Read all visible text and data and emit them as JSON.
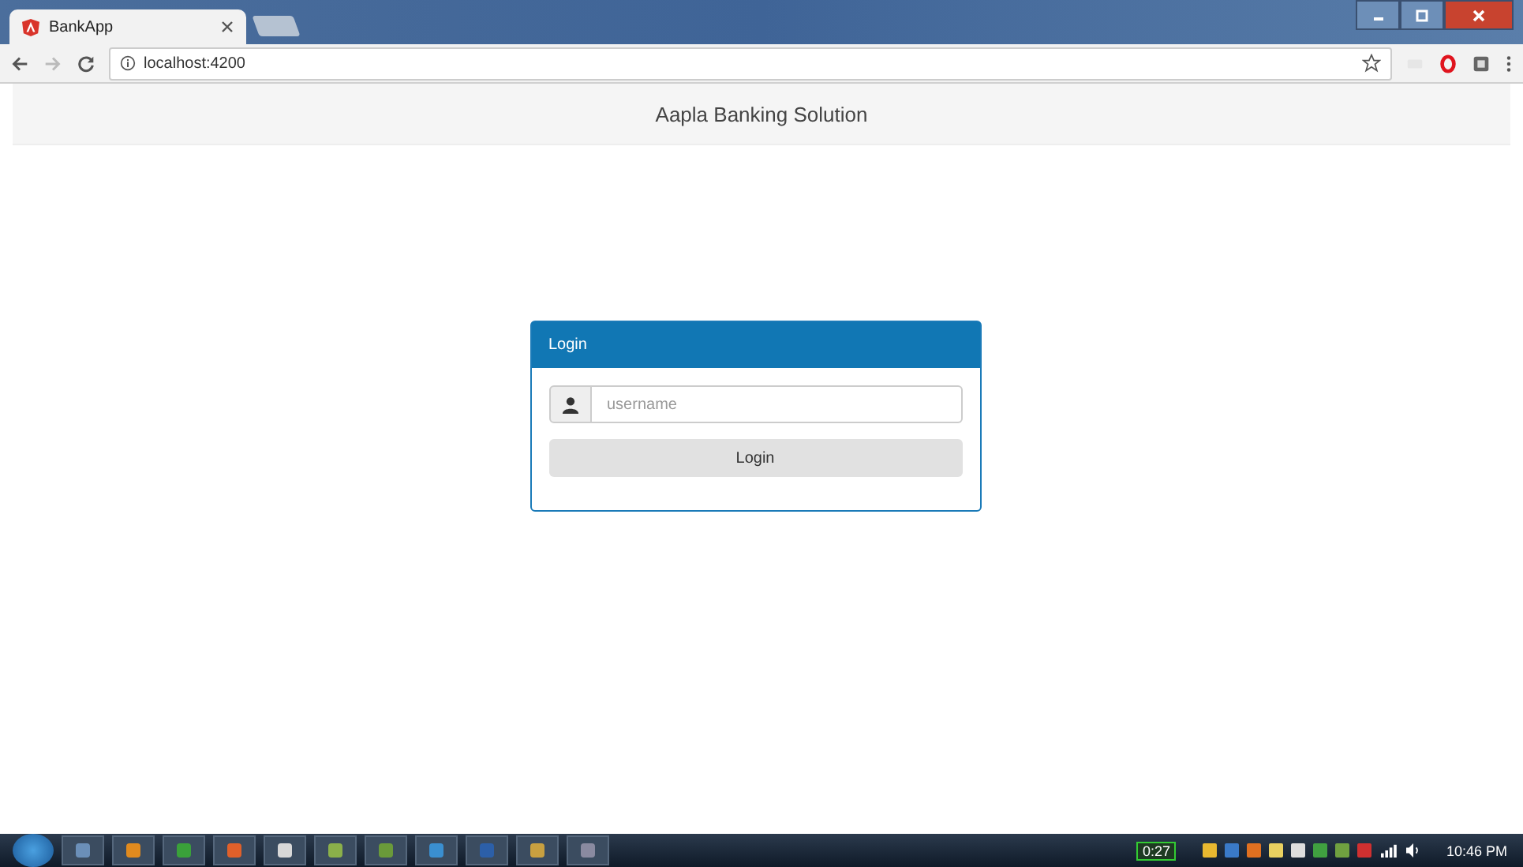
{
  "browser": {
    "tabs": [
      {
        "title": "BankApp",
        "selected": true
      }
    ],
    "address": "localhost:4200"
  },
  "page": {
    "header_title": "Aapla Banking Solution",
    "login": {
      "title": "Login",
      "username_placeholder": "username",
      "button": "Login"
    }
  },
  "taskbar": {
    "battery": "0:27",
    "time": "10:46 PM"
  }
}
